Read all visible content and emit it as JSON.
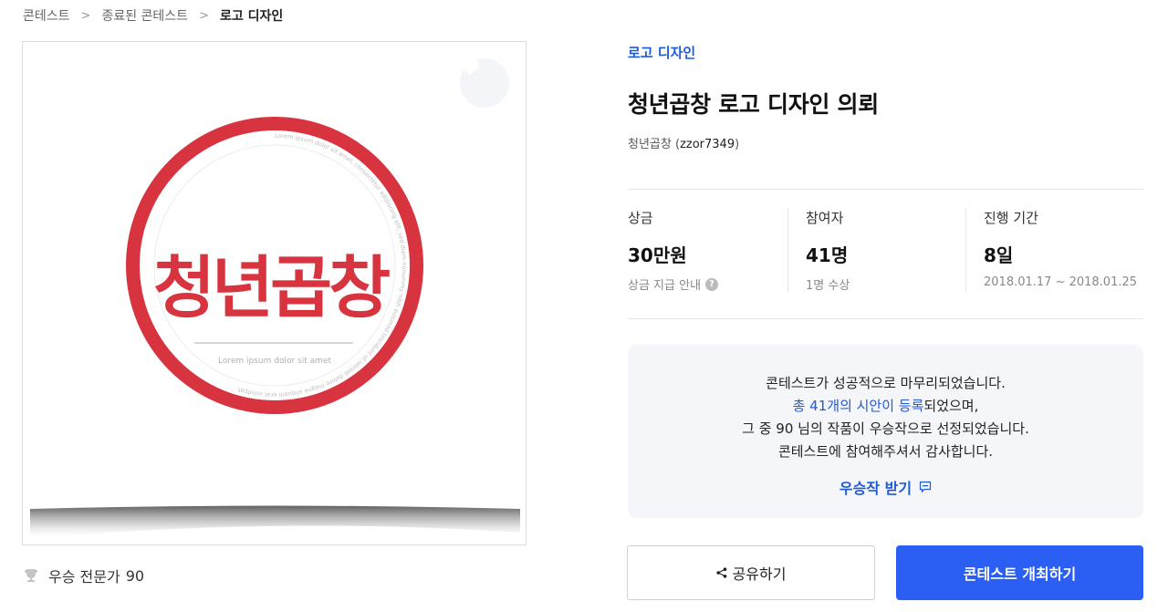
{
  "breadcrumb": [
    "콘테스트",
    "종료된 콘테스트",
    "로고 디자인"
  ],
  "contest": {
    "category": "로고 디자인",
    "title": "청년곱창 로고 디자인 의뢰",
    "host_name": "청년곱창",
    "host_id": "zzor7349"
  },
  "logo": {
    "brand_text": "청년곱창",
    "tagline": "Lorem ipsum dolor sit amet",
    "ring_text": "Lorem ipsum dolor sit amet, consectetur adipiscing elit, sed diam nonummy nibh euismod tincidunt ut laoreet dolore magna aliquam erat volutpat.",
    "accent": "#d8343f",
    "like_icon": "heart-icon"
  },
  "winners": {
    "label": "우승 전문가",
    "count": "90",
    "icon": "trophy-icon"
  },
  "stats": {
    "prize": {
      "label": "상금",
      "value": "30만원",
      "sub": "상금 지급 안내",
      "help_icon": "question-icon",
      "help_glyph": "?"
    },
    "participants": {
      "label": "참여자",
      "value": "41명",
      "sub": "1명 수상"
    },
    "period": {
      "label": "진행 기간",
      "value": "8일",
      "sub": "2018.01.17 ~ 2018.01.25"
    }
  },
  "notice": {
    "line1": "콘테스트가 성공적으로 마무리되었습니다.",
    "line2_highlight": "총 41개의 시안이 등록",
    "line2_rest": "되었으며,",
    "line3_pre": "그 중 ",
    "line3_num": "90",
    "line3_post": " 님의 작품이 우승작으로 선정되었습니다.",
    "line4": "콘테스트에 참여해주셔서 감사합니다.",
    "receive_label": "우승작 받기",
    "receive_icon": "comment-icon"
  },
  "actions": {
    "share_label": "공유하기",
    "share_icon": "share-icon",
    "host_label": "콘테스트 개최하기"
  },
  "colors": {
    "primary": "#2b5ef3",
    "link": "#1f5ad9",
    "notice_bg": "#f5f6f9"
  }
}
